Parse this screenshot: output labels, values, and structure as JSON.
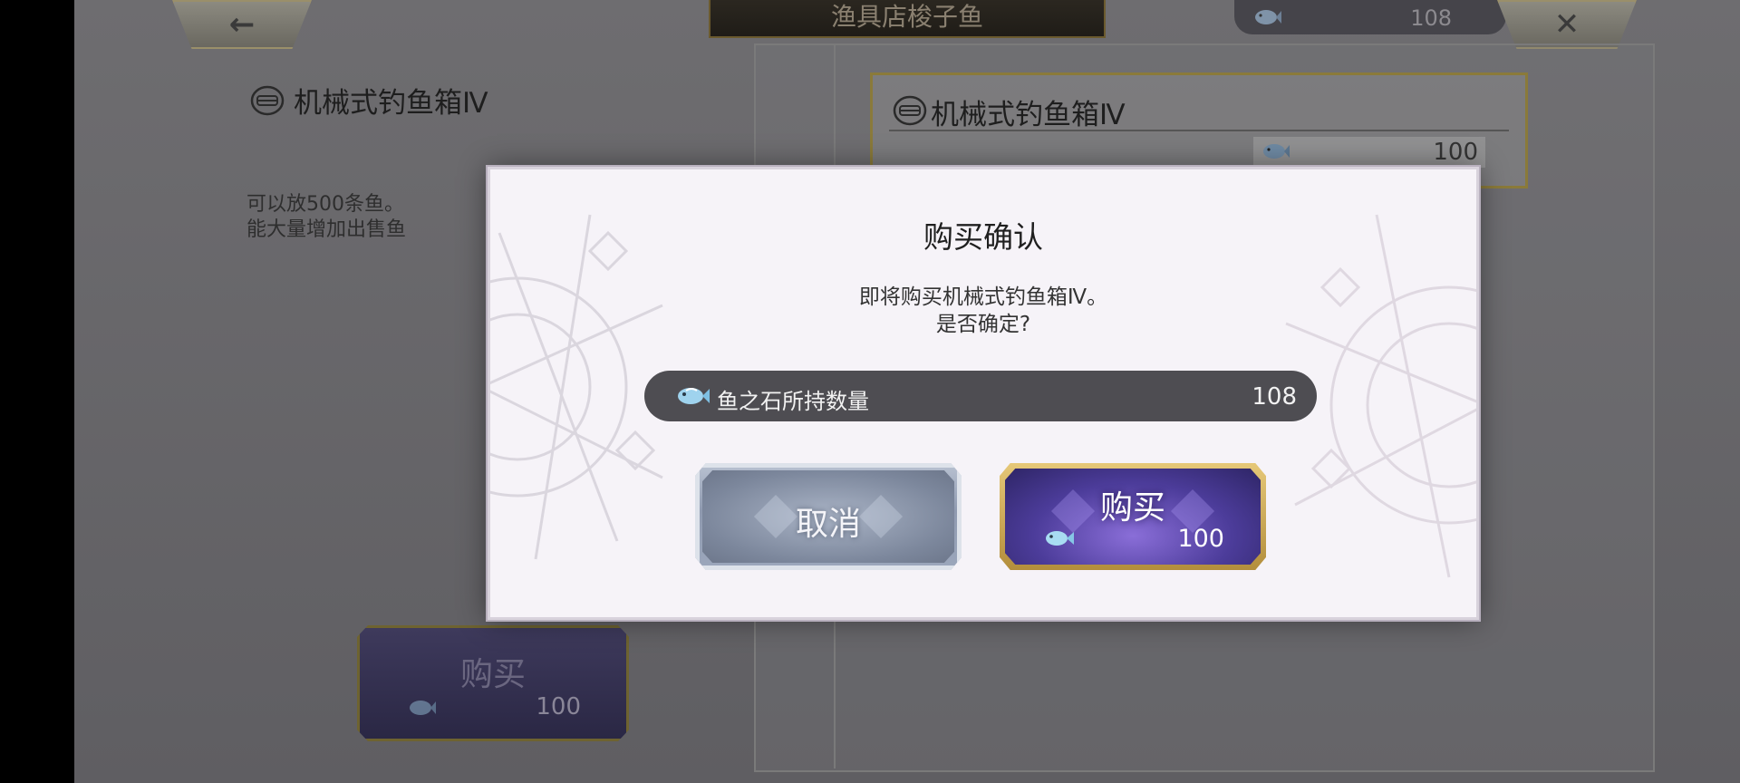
{
  "topbar": {
    "shop_title": "渔具店梭子鱼",
    "currency_amount": "108",
    "back_icon": "back-arrow-icon",
    "close_icon": "close-icon"
  },
  "item": {
    "name": "机械式钓鱼箱Ⅳ",
    "description_line1": "可以放500条鱼。",
    "description_line2": "能大量增加出售鱼"
  },
  "item_card": {
    "name": "机械式钓鱼箱Ⅳ",
    "price": "100"
  },
  "background_buy": {
    "label": "购买",
    "price": "100"
  },
  "dialog": {
    "title": "购买确认",
    "message_line1": "即将购买机械式钓鱼箱Ⅳ。",
    "message_line2": "是否确定?",
    "holding_label": "鱼之石所持数量",
    "holding_amount": "108",
    "cancel_label": "取消",
    "buy_label": "购买",
    "buy_price": "100"
  },
  "colors": {
    "dialog_bg": "#f6f3f8",
    "buy_button": "#4c3c9a",
    "cancel_button": "#8f9ab0",
    "gold_border": "#b38e3c"
  }
}
